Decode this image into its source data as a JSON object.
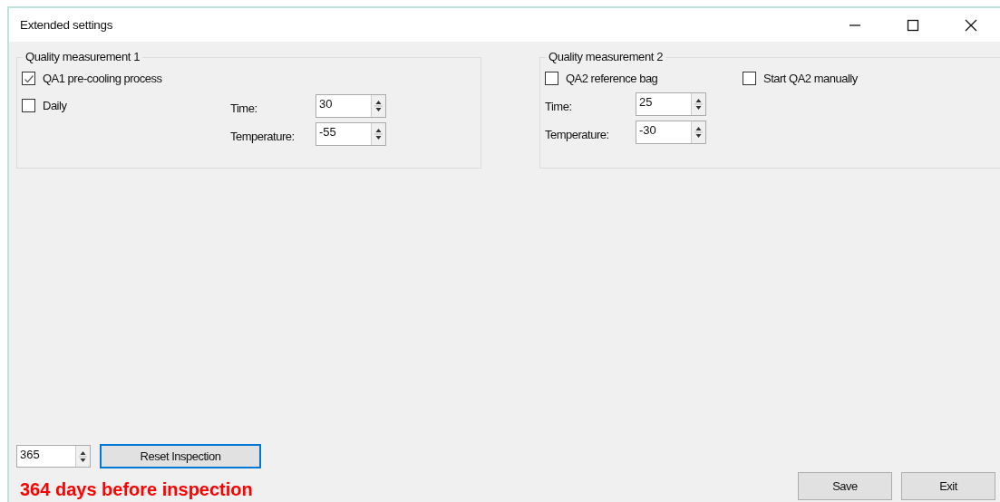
{
  "window": {
    "title": "Extended settings"
  },
  "groups": [
    {
      "title": "Quality measurement 1",
      "kind": "stacked",
      "checkboxes": [
        {
          "label": "QA1 pre-cooling process",
          "checked": true
        },
        {
          "label": "Daily",
          "checked": false
        }
      ],
      "fields": [
        {
          "label": "Time:",
          "value": "30"
        },
        {
          "label": "Temperature:",
          "value": "-55"
        }
      ]
    },
    {
      "title": "Quality measurement 2",
      "kind": "row",
      "checkboxes": [
        {
          "label": "QA2 reference bag",
          "checked": false
        },
        {
          "label": "Start QA2 manually",
          "checked": false
        }
      ],
      "fields": [
        {
          "label": "Time:",
          "value": "25"
        },
        {
          "label": "Temperature:",
          "value": "-30"
        }
      ]
    }
  ],
  "inspection": {
    "days": "365",
    "reset_button": "Reset Inspection",
    "message": "364 days before inspection"
  },
  "buttons": [
    "Save",
    "Exit"
  ]
}
